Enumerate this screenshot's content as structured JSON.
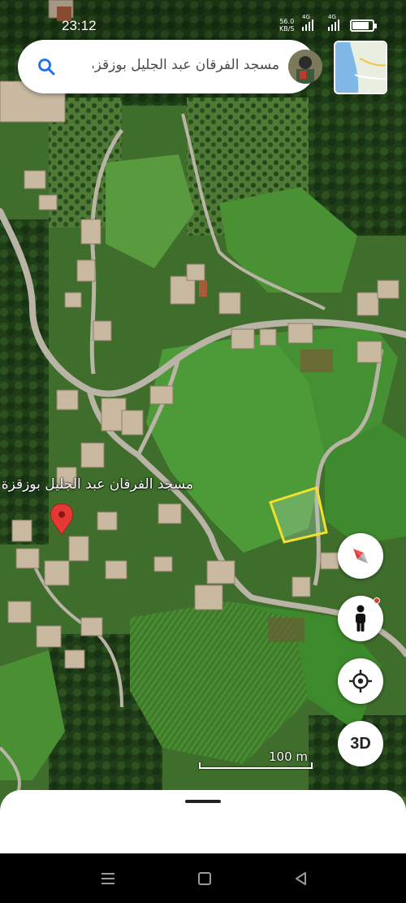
{
  "status_bar": {
    "time": "23:12",
    "net_speed_value": "56.0",
    "net_speed_unit": "KB/S",
    "sim1_type": "4G",
    "sim2_type": "4G",
    "battery_level": 0.85
  },
  "search": {
    "query": "مسجد الفرقان عبد الجليل بوزقزة قدارة",
    "icon": "search-icon"
  },
  "map": {
    "place_label": "مسجد الفرقان عبد الجليل بوزقزة",
    "scale_label": "100 m"
  },
  "controls": {
    "compass_icon": "compass-icon",
    "street_view_icon": "pegman-icon",
    "my_location_icon": "my-location-icon",
    "three_d_label": "3D"
  },
  "colors": {
    "pin": "#e53935",
    "parcel": "#f2e12b",
    "search_icon": "#1a73e8"
  }
}
